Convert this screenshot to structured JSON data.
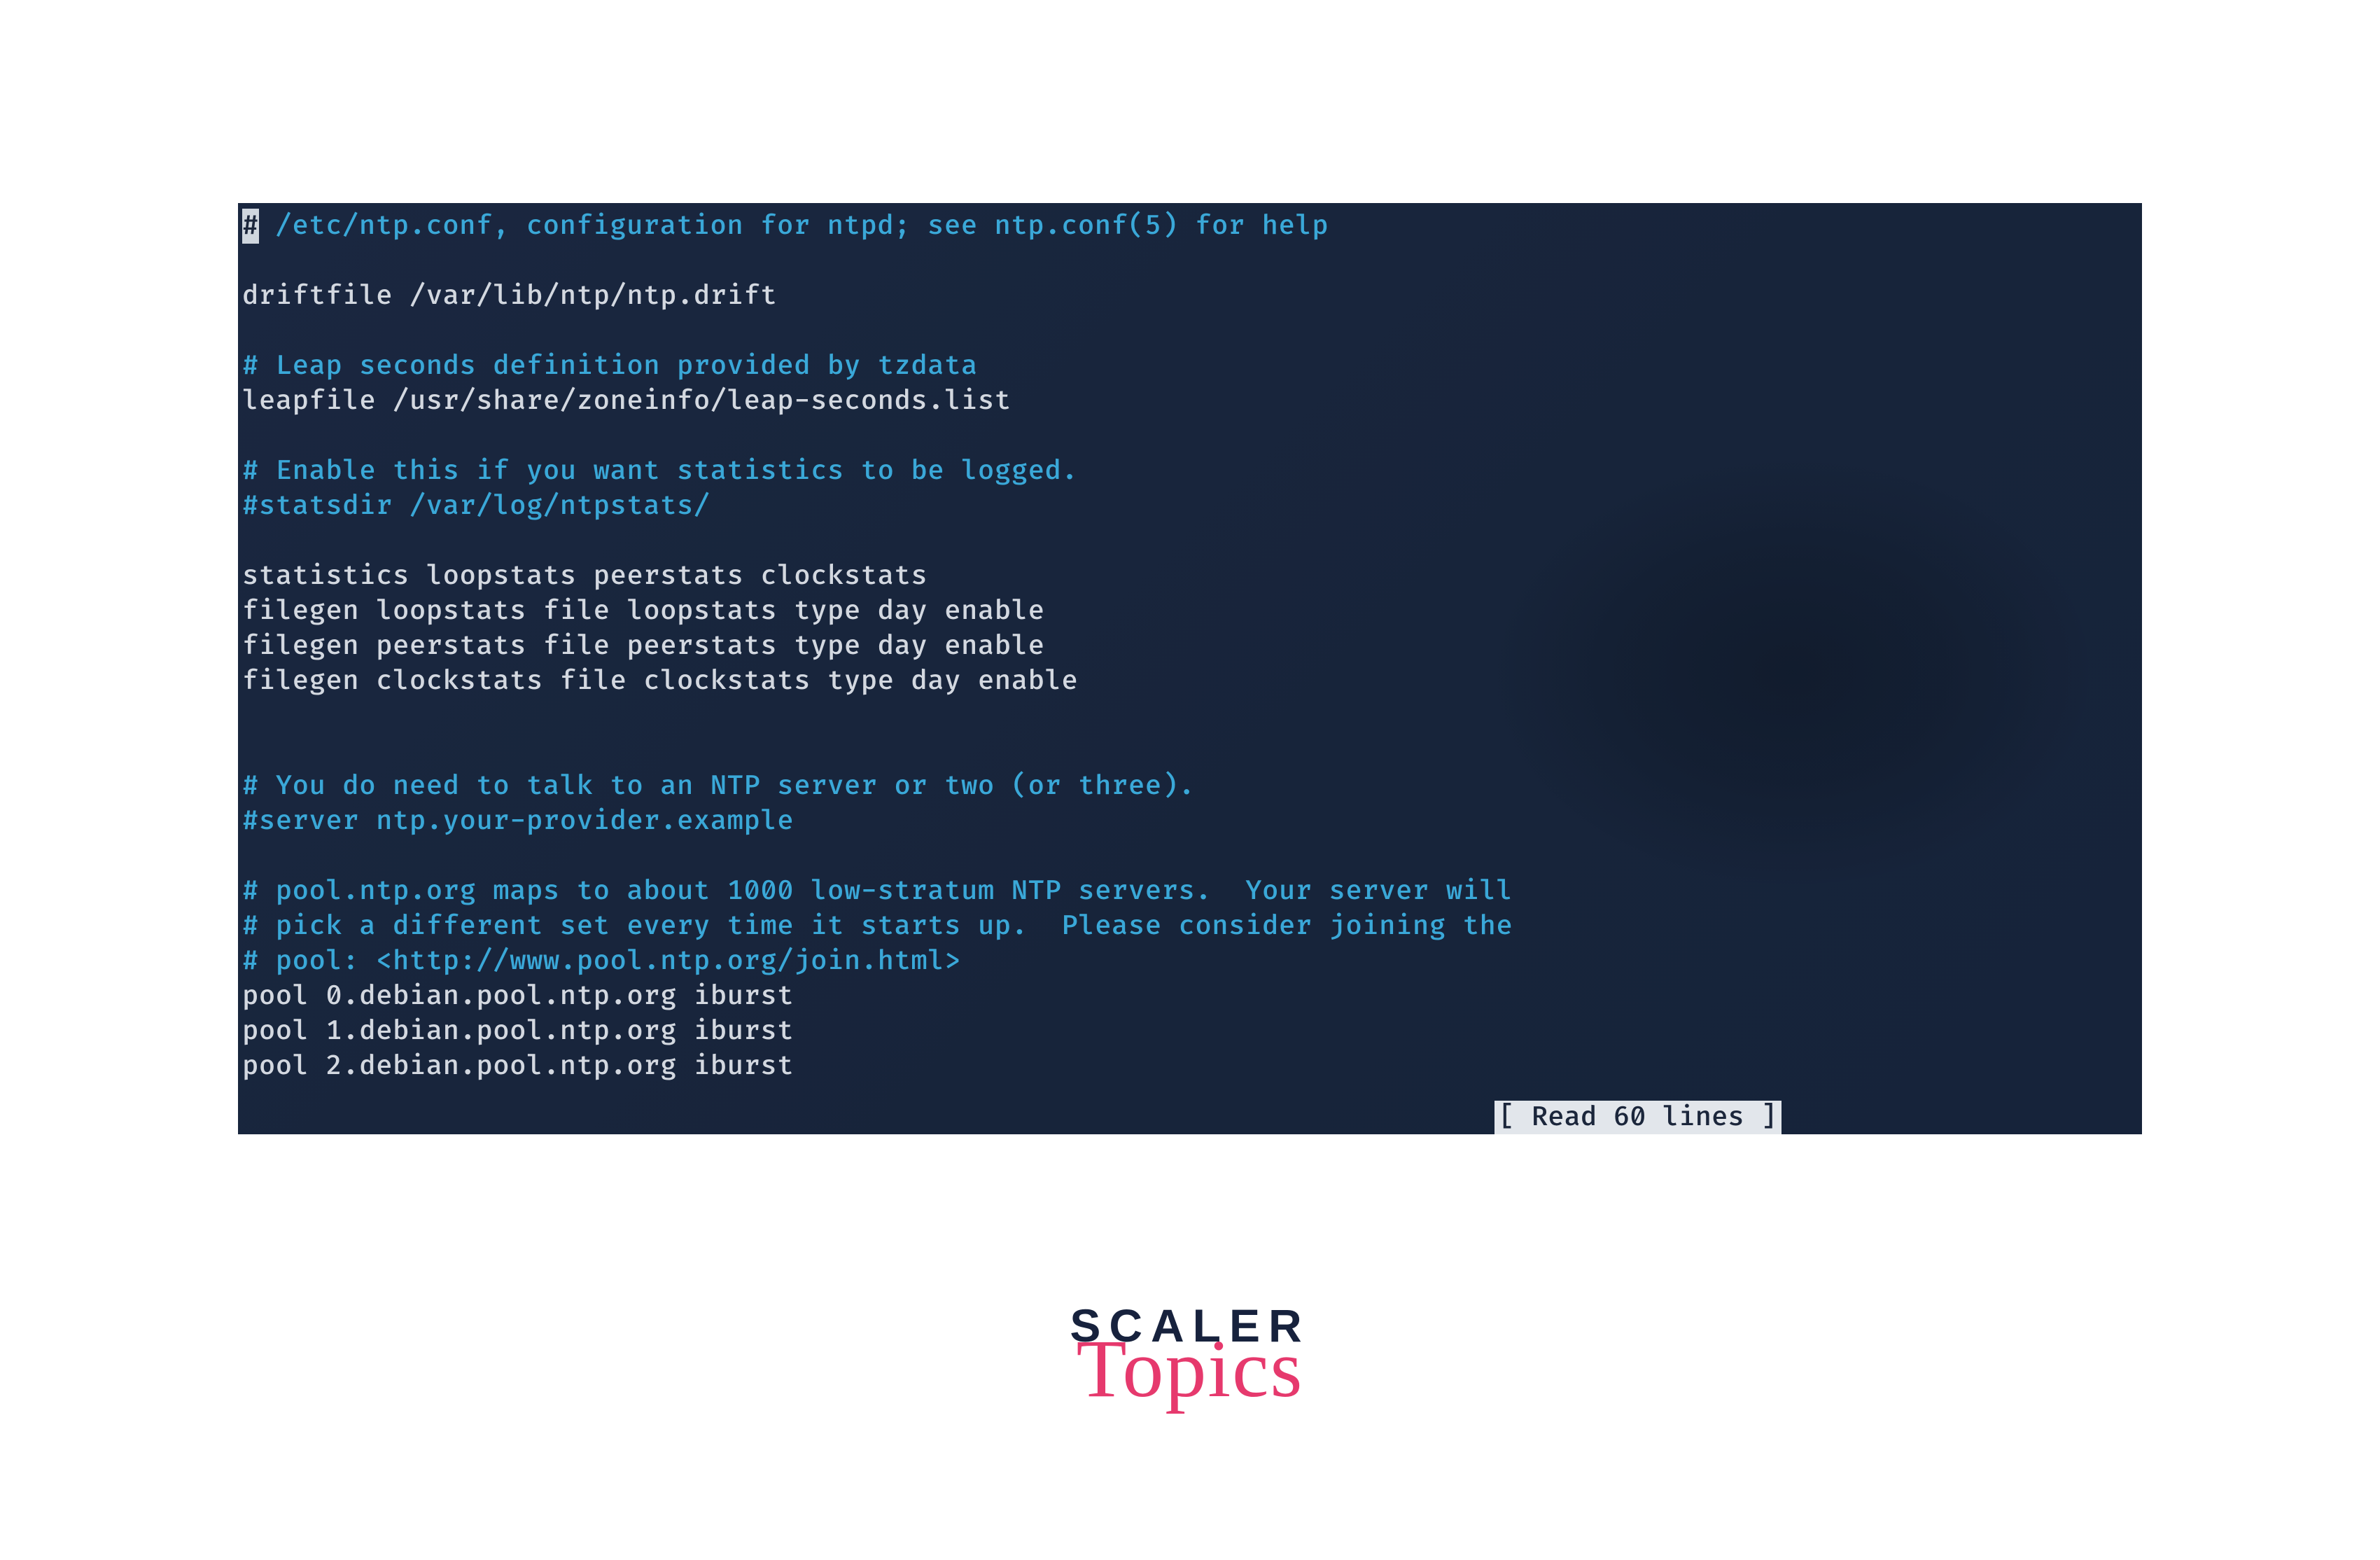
{
  "editor": {
    "cursor_char": "#",
    "status_message": "[ Read 60 lines ]",
    "lines": [
      {
        "type": "first",
        "after_cursor": " /etc/ntp.conf, configuration for ntpd; see ntp.conf(5) for help",
        "cls": "comment"
      },
      {
        "type": "blank"
      },
      {
        "text": "driftfile /var/lib/ntp/ntp.drift",
        "cls": "plain"
      },
      {
        "type": "blank"
      },
      {
        "text": "# Leap seconds definition provided by tzdata",
        "cls": "comment"
      },
      {
        "text": "leapfile /usr/share/zoneinfo/leap-seconds.list",
        "cls": "plain"
      },
      {
        "type": "blank"
      },
      {
        "text": "# Enable this if you want statistics to be logged.",
        "cls": "comment"
      },
      {
        "text": "#statsdir /var/log/ntpstats/",
        "cls": "comment"
      },
      {
        "type": "blank"
      },
      {
        "text": "statistics loopstats peerstats clockstats",
        "cls": "plain"
      },
      {
        "text": "filegen loopstats file loopstats type day enable",
        "cls": "plain"
      },
      {
        "text": "filegen peerstats file peerstats type day enable",
        "cls": "plain"
      },
      {
        "text": "filegen clockstats file clockstats type day enable",
        "cls": "plain"
      },
      {
        "type": "blank"
      },
      {
        "type": "blank"
      },
      {
        "text": "# You do need to talk to an NTP server or two (or three).",
        "cls": "comment"
      },
      {
        "text": "#server ntp.your-provider.example",
        "cls": "comment"
      },
      {
        "type": "blank"
      },
      {
        "text": "# pool.ntp.org maps to about 1000 low-stratum NTP servers.  Your server will",
        "cls": "comment"
      },
      {
        "text": "# pick a different set every time it starts up.  Please consider joining the",
        "cls": "comment"
      },
      {
        "text": "# pool: <http://www.pool.ntp.org/join.html>",
        "cls": "comment"
      },
      {
        "text": "pool 0.debian.pool.ntp.org iburst",
        "cls": "plain"
      },
      {
        "text": "pool 1.debian.pool.ntp.org iburst",
        "cls": "plain"
      },
      {
        "text": "pool 2.debian.pool.ntp.org iburst",
        "cls": "plain"
      }
    ]
  },
  "branding": {
    "top": "SCALER",
    "bottom": "Topics"
  },
  "colors": {
    "terminal_bg": "#1b263b",
    "comment": "#3aa8d8",
    "plain": "#d3d8e0",
    "cursor_bg": "#cfd6de",
    "status_bg": "#e2e6eb",
    "brand_dark": "#17223d",
    "brand_pink": "#e6396d"
  }
}
